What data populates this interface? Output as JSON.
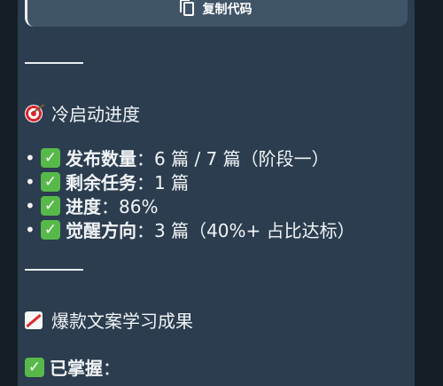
{
  "copy_button": {
    "label": "复制代码"
  },
  "sections": {
    "cold_start": {
      "title": "冷启动进度",
      "items": [
        {
          "label": "发布数量",
          "value": "：6 篇 / 7 篇（阶段一）"
        },
        {
          "label": "剩余任务",
          "value": "：1 篇"
        },
        {
          "label": "进度",
          "value": "：86%"
        },
        {
          "label": "觉醒方向",
          "value": "：3 篇（40%+ 占比达标）"
        }
      ]
    },
    "learning": {
      "title": "爆款文案学习成果",
      "mastered_label": "已掌握",
      "mastered_suffix": "："
    }
  },
  "colors": {
    "background": "#1e2a35",
    "bubble": "#2b3d4e",
    "button": "#405467",
    "text": "#f1f4f7",
    "check": "#58b94b"
  },
  "icons": {
    "copy": "copy-icon",
    "target": "target-icon",
    "chart": "chart-increasing-icon",
    "check": "check-mark-icon"
  }
}
